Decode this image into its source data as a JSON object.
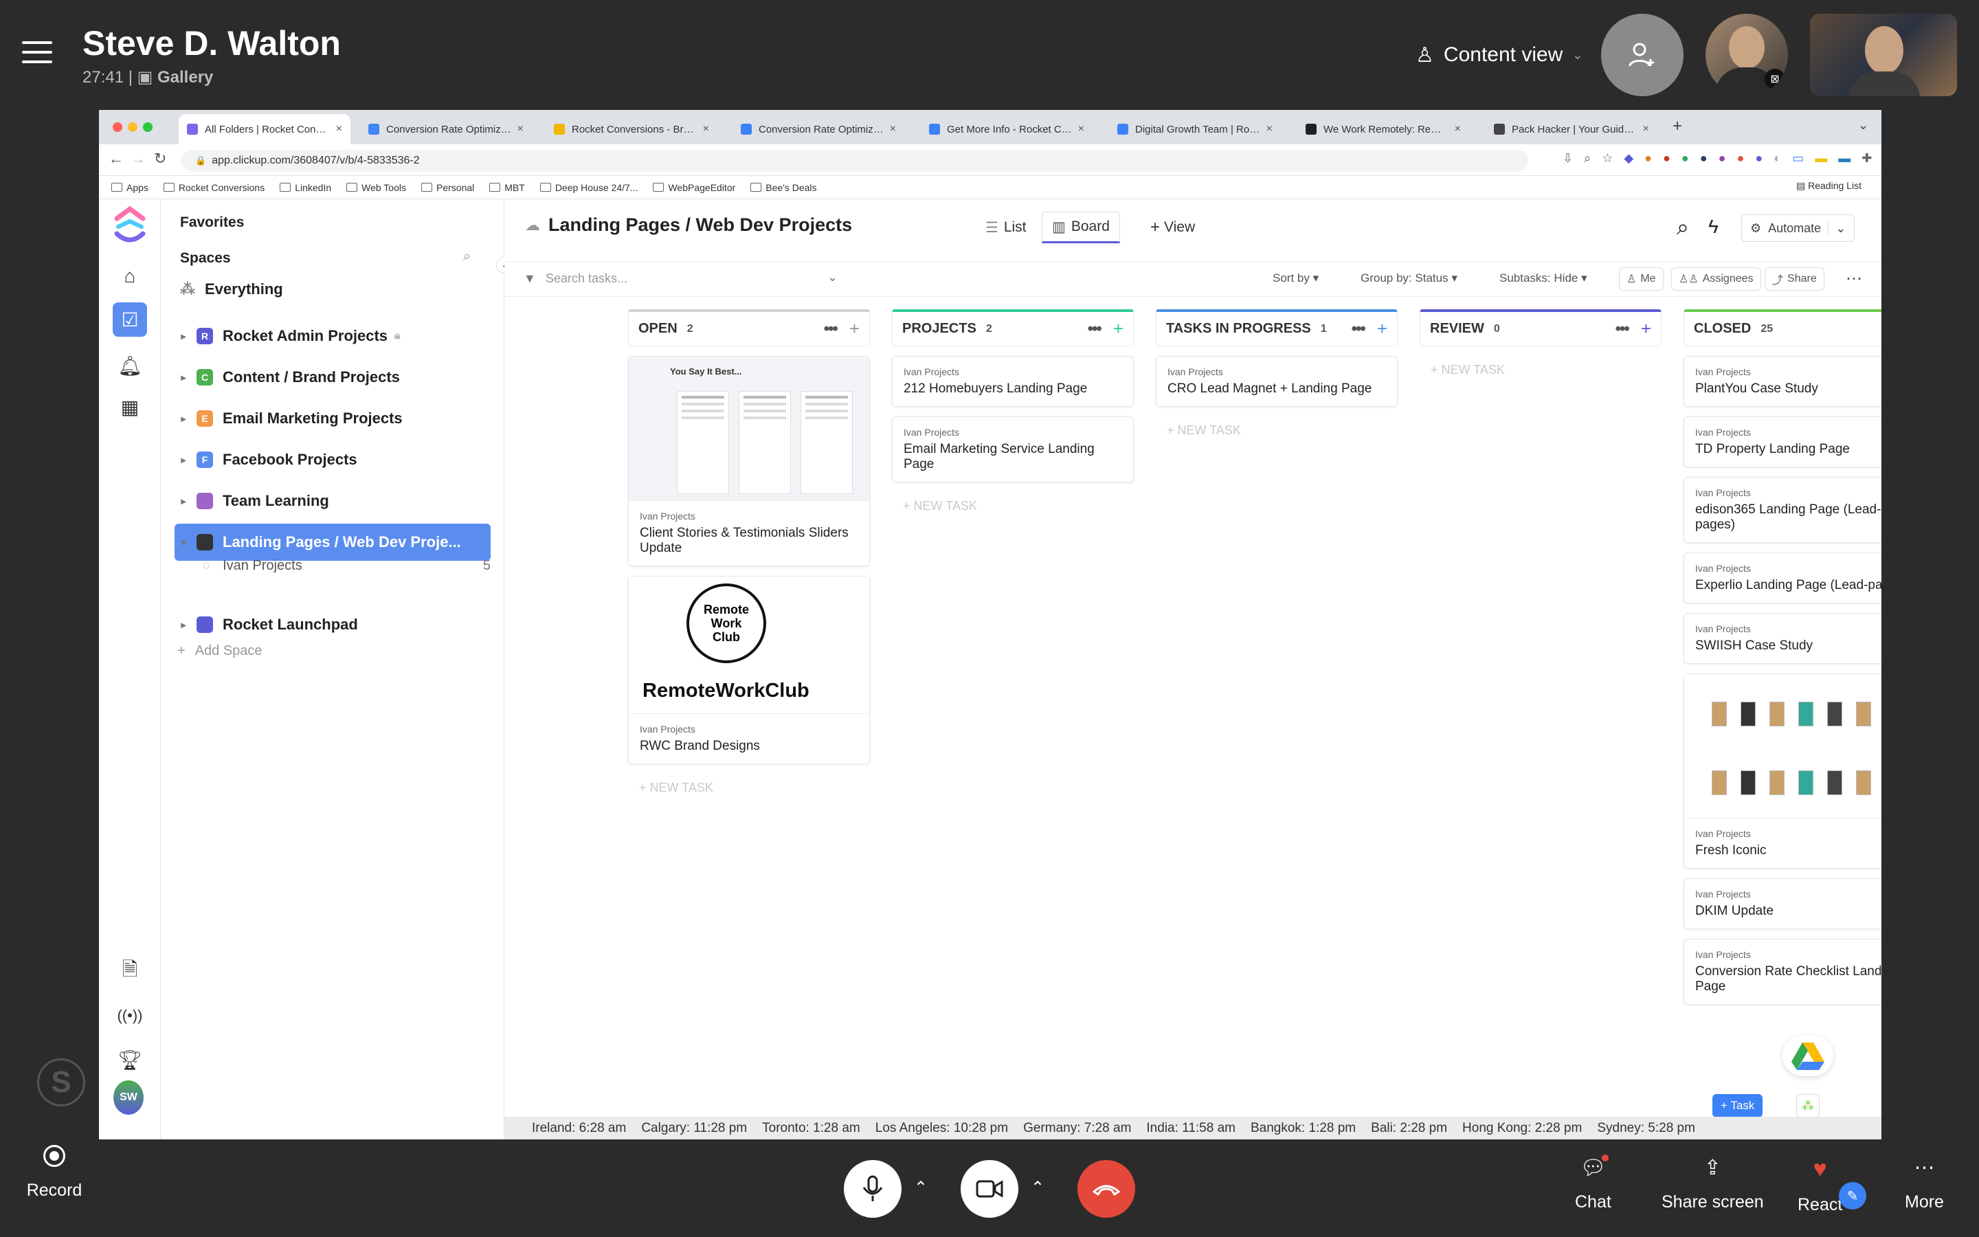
{
  "call": {
    "caller_name": "Steve D. Walton",
    "duration": "27:41",
    "separator": "|",
    "view": "Gallery",
    "content_view": "Content view"
  },
  "browser": {
    "tabs": [
      {
        "label": "All Folders | Rocket Conversion",
        "fav_color": "#7b68ee"
      },
      {
        "label": "Conversion Rate Optimization",
        "fav_color": "#4285f4"
      },
      {
        "label": "Rocket Conversions - Brand Gu",
        "fav_color": "#f4b400"
      },
      {
        "label": "Conversion Rate Optimization",
        "fav_color": "#3b82f6"
      },
      {
        "label": "Get More Info - Rocket Conver",
        "fav_color": "#3b82f6"
      },
      {
        "label": "Digital Growth Team | Rocket C",
        "fav_color": "#3b82f6"
      },
      {
        "label": "We Work Remotely: Remote job",
        "fav_color": "#222222"
      },
      {
        "label": "Pack Hacker | Your Guide to Sr",
        "fav_color": "#444444"
      }
    ],
    "url": "app.clickup.com/3608407/v/b/4-5833536-2",
    "bookmarks": [
      "Apps",
      "Rocket Conversions",
      "LinkedIn",
      "Web Tools",
      "Personal",
      "MBT",
      "Deep House 24/7...",
      "WebPageEditor",
      "Bee's Deals"
    ],
    "reading_list": "Reading List"
  },
  "sidebar": {
    "favorites": "Favorites",
    "spaces": "Spaces",
    "everything": "Everything",
    "items": [
      {
        "badge": "R",
        "label": "Rocket Admin Projects",
        "color": "#5b5bd6"
      },
      {
        "badge": "C",
        "label": "Content / Brand Projects",
        "color": "#4caf50"
      },
      {
        "badge": "E",
        "label": "Email Marketing Projects",
        "color": "#f2994a"
      },
      {
        "badge": "F",
        "label": "Facebook Projects",
        "color": "#5b8def"
      },
      {
        "badge": "",
        "label": "Team Learning",
        "color": "#a064c8"
      },
      {
        "badge": "",
        "label": "Landing Pages / Web Dev Proje...",
        "color": "#333333"
      },
      {
        "badge": "",
        "label": "Rocket Launchpad",
        "color": "#5b5bd6"
      }
    ],
    "sub_item": {
      "label": "Ivan Projects",
      "count": "5"
    },
    "add_space": "Add Space"
  },
  "board": {
    "title": "Landing Pages / Web Dev Projects",
    "view_list": "List",
    "view_board": "Board",
    "view_add": "View",
    "automate": "Automate",
    "search_placeholder": "Search tasks...",
    "sort_by": "Sort by",
    "group_by": "Group by:",
    "group_value": "Status",
    "subtasks": "Subtasks:",
    "subtasks_value": "Hide",
    "me": "Me",
    "assignees": "Assignees",
    "share": "Share",
    "new_task": "+ NEW TASK",
    "list_name": "Ivan Projects",
    "columns": [
      {
        "name": "OPEN",
        "count": "2",
        "color": "#d3d3d3",
        "cards": [
          "Client Stories & Testimonials Sliders Update",
          "RWC Brand Designs"
        ]
      },
      {
        "name": "PROJECTS",
        "count": "2",
        "color": "#2ecc9a",
        "cards": [
          "212 Homebuyers Landing Page",
          "Email Marketing Service Landing Page"
        ]
      },
      {
        "name": "TASKS IN PROGRESS",
        "count": "1",
        "color": "#4a90e2",
        "cards": [
          "CRO Lead Magnet + Landing Page"
        ]
      },
      {
        "name": "REVIEW",
        "count": "0",
        "color": "#5b5bd6",
        "cards": []
      },
      {
        "name": "CLOSED",
        "count": "25",
        "color": "#6bc950",
        "cards": [
          "PlantYou Case Study",
          "TD Property Landing Page",
          "edison365 Landing Page (Lead-pages)",
          "Experlio Landing Page (Lead-pages)",
          "SWIISH Case Study",
          "Fresh Iconic",
          "DKIM Update",
          "Conversion Rate Checklist Landing Page"
        ]
      }
    ],
    "thumb_text": {
      "rwc_logo": "Remote Work Club",
      "rwc_name": "RemoteWorkClub",
      "testimonial_head": "You Say It Best..."
    },
    "task_button": "+ Task"
  },
  "world_clock": [
    "Ireland: 6:28 am",
    "Calgary: 11:28 pm",
    "Toronto: 1:28 am",
    "Los Angeles: 10:28 pm",
    "Germany: 7:28 am",
    "India: 11:58 am",
    "Bangkok: 1:28 pm",
    "Bali: 2:28 pm",
    "Hong Kong: 2:28 pm",
    "Sydney: 5:28 pm"
  ],
  "bottom": {
    "record": "Record",
    "chat": "Chat",
    "share_screen": "Share screen",
    "react": "React",
    "more": "More"
  }
}
